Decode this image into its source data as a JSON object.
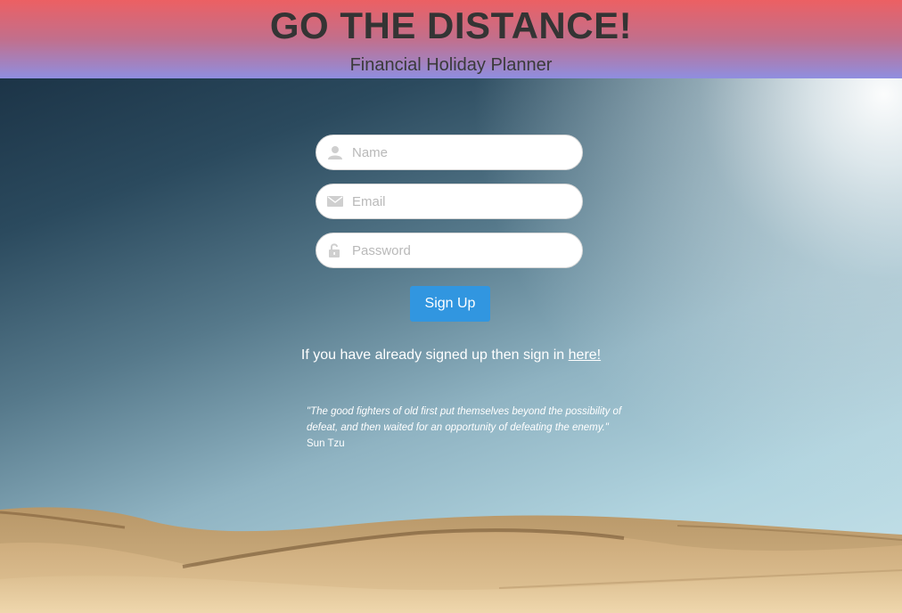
{
  "header": {
    "title": "GO THE DISTANCE!",
    "subtitle": "Financial Holiday Planner"
  },
  "form": {
    "name": {
      "placeholder": "Name",
      "icon": "user-icon"
    },
    "email": {
      "placeholder": "Email",
      "icon": "envelope-icon"
    },
    "password": {
      "placeholder": "Password",
      "icon": "unlock-icon"
    },
    "submit_label": "Sign Up"
  },
  "signin": {
    "prefix": "If you have already signed up then sign in ",
    "link_text": "here!"
  },
  "quote": {
    "text": "\"The good fighters of old first put themselves beyond the possibility of defeat, and then waited for an opportunity of defeating the enemy.\"",
    "author": "Sun Tzu"
  },
  "colors": {
    "header_top": "#ec6063",
    "header_bottom": "#8f8ee0",
    "button": "#3196e0",
    "title_text": "#343434"
  }
}
